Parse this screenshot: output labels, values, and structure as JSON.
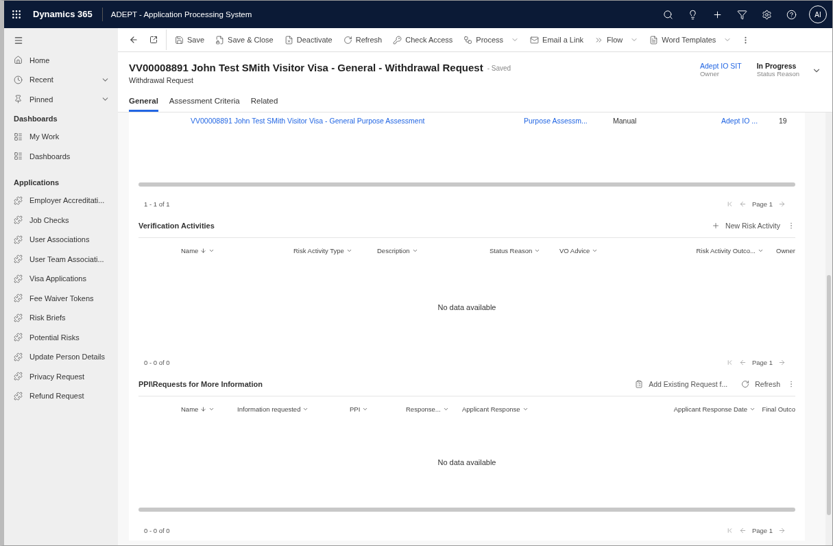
{
  "top_bar": {
    "brand": "Dynamics 365",
    "app_name": "ADEPT - Application Processing System",
    "avatar": "AI"
  },
  "command_bar": [
    {
      "label": "Save",
      "dropdown": false
    },
    {
      "label": "Save & Close",
      "dropdown": false
    },
    {
      "label": "Deactivate",
      "dropdown": false
    },
    {
      "label": "Refresh",
      "dropdown": false
    },
    {
      "label": "Check Access",
      "dropdown": false
    },
    {
      "label": "Process",
      "dropdown": true
    },
    {
      "label": "Email a Link",
      "dropdown": false
    },
    {
      "label": "Flow",
      "dropdown": true
    },
    {
      "label": "Word Templates",
      "dropdown": true
    }
  ],
  "sidebar": {
    "nav": [
      {
        "label": "Home",
        "expandable": false
      },
      {
        "label": "Recent",
        "expandable": true
      },
      {
        "label": "Pinned",
        "expandable": true
      }
    ],
    "groups": [
      {
        "title": "Dashboards",
        "items": [
          {
            "label": "My Work"
          },
          {
            "label": "Dashboards"
          }
        ]
      },
      {
        "title": "Applications",
        "items": [
          {
            "label": "Employer Accreditati..."
          },
          {
            "label": "Job Checks"
          },
          {
            "label": "User Associations"
          },
          {
            "label": "User Team Associati..."
          },
          {
            "label": "Visa Applications"
          },
          {
            "label": "Fee Waiver Tokens"
          },
          {
            "label": "Risk Briefs"
          },
          {
            "label": "Potential Risks"
          },
          {
            "label": "Update Person Details"
          },
          {
            "label": "Privacy Request"
          },
          {
            "label": "Refund Request"
          }
        ]
      }
    ]
  },
  "record": {
    "title": "VV00008891 John Test SMith Visitor Visa - General - Withdrawal Request",
    "save_status": "- Saved",
    "entity": "Withdrawal Request",
    "fields": [
      {
        "value": "Adept IO SIT",
        "label": "Owner",
        "link": true
      },
      {
        "value": "In Progress",
        "label": "Status Reason",
        "link": false
      }
    ],
    "tabs": [
      {
        "label": "General",
        "selected": true
      },
      {
        "label": "Assessment Criteria",
        "selected": false
      },
      {
        "label": "Related",
        "selected": false
      }
    ]
  },
  "assessment_grid": {
    "rows": [
      {
        "cells": [
          {
            "text": "VV00008891 John Test SMith Visitor Visa - General Purpose Assessment",
            "link": true
          },
          {
            "text": "Purpose Assessm...",
            "link": true
          },
          {
            "text": "Manual",
            "link": false
          },
          {
            "text": "Adept IO ...",
            "link": true
          },
          {
            "text": "19",
            "link": false
          }
        ]
      }
    ],
    "count": "1 - 1 of 1",
    "page": "Page 1"
  },
  "verification_activities": {
    "title": "Verification Activities",
    "actions": [
      {
        "label": "New Risk Activity"
      }
    ],
    "columns": [
      {
        "label": "Name",
        "sorted": true
      },
      {
        "label": "Risk Activity Type",
        "sorted": false
      },
      {
        "label": "Description",
        "sorted": false
      },
      {
        "label": "Status Reason",
        "sorted": false
      },
      {
        "label": "VO Advice",
        "sorted": false
      },
      {
        "label": "Risk Activity Outco...",
        "sorted": false
      },
      {
        "label": "Owner",
        "sorted": false,
        "caret": false
      }
    ],
    "empty": "No data available",
    "count": "0 - 0 of 0",
    "page": "Page 1"
  },
  "requests_for_information": {
    "title": "PPI\\Requests for More Information",
    "actions": [
      {
        "label": "Add Existing Request f..."
      },
      {
        "label": "Refresh"
      }
    ],
    "columns": [
      {
        "label": "Name",
        "sorted": true
      },
      {
        "label": "Information requested",
        "sorted": false
      },
      {
        "label": "PPI",
        "sorted": false
      },
      {
        "label": "Response...",
        "sorted": false
      },
      {
        "label": "Applicant Response",
        "sorted": false
      },
      {
        "label": "Applicant Response Date",
        "sorted": false
      },
      {
        "label": "Final Outco",
        "sorted": false,
        "caret": false
      }
    ],
    "empty": "No data available",
    "count": "0 - 0 of 0",
    "page": "Page 1"
  }
}
